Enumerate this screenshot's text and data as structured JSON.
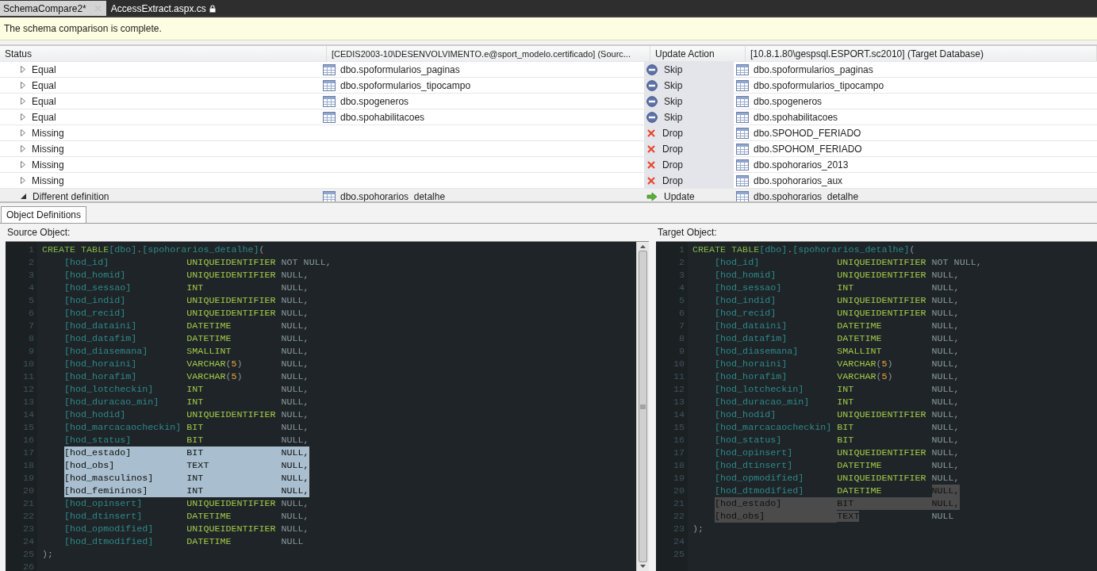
{
  "tabs": [
    {
      "label": "SchemaCompare2*",
      "selected": true,
      "locked": false
    },
    {
      "label": "AccessExtract.aspx.cs",
      "selected": false,
      "locked": true
    }
  ],
  "info_bar": {
    "message": "The schema comparison is complete."
  },
  "grid": {
    "columns": [
      "Status",
      "[CEDIS2003-10\\DESENVOLVIMENTO.e@sport_modelo.certificado] (Sourc...",
      "Update Action",
      "[10.8.1.80\\gespsql.ESPORT.sc2010] (Target Database)"
    ],
    "rows": [
      {
        "status": "Equal",
        "expanded": false,
        "selected": false,
        "source": "dbo.spoformularios_paginas",
        "action": {
          "kind": "skip",
          "label": "Skip"
        },
        "target": "dbo.spoformularios_paginas"
      },
      {
        "status": "Equal",
        "expanded": false,
        "selected": false,
        "source": "dbo.spoformularios_tipocampo",
        "action": {
          "kind": "skip",
          "label": "Skip"
        },
        "target": "dbo.spoformularios_tipocampo"
      },
      {
        "status": "Equal",
        "expanded": false,
        "selected": false,
        "source": "dbo.spogeneros",
        "action": {
          "kind": "skip",
          "label": "Skip"
        },
        "target": "dbo.spogeneros"
      },
      {
        "status": "Equal",
        "expanded": false,
        "selected": false,
        "source": "dbo.spohabilitacoes",
        "action": {
          "kind": "skip",
          "label": "Skip"
        },
        "target": "dbo.spohabilitacoes"
      },
      {
        "status": "Missing",
        "expanded": false,
        "selected": false,
        "action": {
          "kind": "drop",
          "label": "Drop"
        },
        "target": "dbo.SPOHOD_FERIADO"
      },
      {
        "status": "Missing",
        "expanded": false,
        "selected": false,
        "action": {
          "kind": "drop",
          "label": "Drop"
        },
        "target": "dbo.SPOHOM_FERIADO"
      },
      {
        "status": "Missing",
        "expanded": false,
        "selected": false,
        "action": {
          "kind": "drop",
          "label": "Drop"
        },
        "target": "dbo.spohorarios_2013"
      },
      {
        "status": "Missing",
        "expanded": false,
        "selected": false,
        "action": {
          "kind": "drop",
          "label": "Drop"
        },
        "target": "dbo.spohorarios_aux"
      },
      {
        "status": "Different definition",
        "expanded": true,
        "selected": true,
        "source": "dbo.spohorarios_detalhe",
        "action": {
          "kind": "update",
          "label": "Update"
        },
        "target": "dbo.spohorarios_detalhe"
      }
    ]
  },
  "definitions": {
    "tab": {
      "label": "Object Definitions",
      "selected": true
    },
    "panes": [
      {
        "title": "Source Object:",
        "kind": "source",
        "scrollbar": true,
        "lines": [
          {
            "kind": "create",
            "n": "1",
            "keyword": "CREATE TABLE",
            "schema": "[dbo]",
            "dot": ".",
            "table": "[spohorarios_detalhe]",
            "paren": "("
          },
          {
            "kind": "column",
            "n": "2",
            "name": "[hod_id]",
            "type": "UNIQUEIDENTIFIER",
            "nullability": "NOT NULL,",
            "highlight": {
              "name": false,
              "type": false,
              "nullability": false
            }
          },
          {
            "kind": "column",
            "n": "3",
            "name": "[hod_homid]",
            "type": "UNIQUEIDENTIFIER",
            "nullability": "NULL,",
            "highlight": {
              "name": false,
              "type": false,
              "nullability": false
            }
          },
          {
            "kind": "column",
            "n": "4",
            "name": "[hod_sessao]",
            "type": "INT",
            "nullability": "NULL,",
            "highlight": {
              "name": false,
              "type": false,
              "nullability": false
            }
          },
          {
            "kind": "column",
            "n": "5",
            "name": "[hod_indid]",
            "type": "UNIQUEIDENTIFIER",
            "nullability": "NULL,",
            "highlight": {
              "name": false,
              "type": false,
              "nullability": false
            }
          },
          {
            "kind": "column",
            "n": "6",
            "name": "[hod_recid]",
            "type": "UNIQUEIDENTIFIER",
            "nullability": "NULL,",
            "highlight": {
              "name": false,
              "type": false,
              "nullability": false
            }
          },
          {
            "kind": "column",
            "n": "7",
            "name": "[hod_dataini]",
            "type": "DATETIME",
            "nullability": "NULL,",
            "highlight": {
              "name": false,
              "type": false,
              "nullability": false
            }
          },
          {
            "kind": "column",
            "n": "8",
            "name": "[hod_datafim]",
            "type": "DATETIME",
            "nullability": "NULL,",
            "highlight": {
              "name": false,
              "type": false,
              "nullability": false
            }
          },
          {
            "kind": "column",
            "n": "9",
            "name": "[hod_diasemana]",
            "type": "SMALLINT",
            "nullability": "NULL,",
            "highlight": {
              "name": false,
              "type": false,
              "nullability": false
            }
          },
          {
            "kind": "column",
            "n": "10",
            "name": "[hod_horaini]",
            "type": "VARCHAR",
            "size": [
              "(",
              "5",
              ")"
            ],
            "nullability": "NULL,",
            "highlight": {
              "name": false,
              "type": false,
              "nullability": false
            }
          },
          {
            "kind": "column",
            "n": "11",
            "name": "[hod_horafim]",
            "type": "VARCHAR",
            "size": [
              "(",
              "5",
              ")"
            ],
            "nullability": "NULL,",
            "highlight": {
              "name": false,
              "type": false,
              "nullability": false
            }
          },
          {
            "kind": "column",
            "n": "12",
            "name": "[hod_lotcheckin]",
            "type": "INT",
            "nullability": "NULL,",
            "highlight": {
              "name": false,
              "type": false,
              "nullability": false
            }
          },
          {
            "kind": "column",
            "n": "13",
            "name": "[hod_duracao_min]",
            "type": "INT",
            "nullability": "NULL,",
            "highlight": {
              "name": false,
              "type": false,
              "nullability": false
            }
          },
          {
            "kind": "column",
            "n": "14",
            "name": "[hod_hodid]",
            "type": "UNIQUEIDENTIFIER",
            "nullability": "NULL,",
            "highlight": {
              "name": false,
              "type": false,
              "nullability": false
            }
          },
          {
            "kind": "column",
            "n": "15",
            "name": "[hod_marcacaocheckin]",
            "type": "BIT",
            "nullability": "NULL,",
            "highlight": {
              "name": false,
              "type": false,
              "nullability": false
            }
          },
          {
            "kind": "column",
            "n": "16",
            "name": "[hod_status]",
            "type": "BIT",
            "nullability": "NULL,",
            "highlight": {
              "name": false,
              "type": false,
              "nullability": false
            }
          },
          {
            "kind": "column",
            "n": "17",
            "name": "[hod_estado]",
            "type": "BIT",
            "nullability": "NULL,",
            "highlight": {
              "name": true,
              "type": true,
              "nullability": true
            }
          },
          {
            "kind": "column",
            "n": "18",
            "name": "[hod_obs]",
            "type": "TEXT",
            "nullability": "NULL,",
            "highlight": {
              "name": true,
              "type": true,
              "nullability": true
            }
          },
          {
            "kind": "column",
            "n": "19",
            "name": "[hod_masculinos]",
            "type": "INT",
            "nullability": "NULL,",
            "highlight": {
              "name": true,
              "type": true,
              "nullability": true
            }
          },
          {
            "kind": "column",
            "n": "20",
            "name": "[hod_femininos]",
            "type": "INT",
            "nullability": "NULL,",
            "highlight": {
              "name": true,
              "type": true,
              "nullability": true
            }
          },
          {
            "kind": "column",
            "n": "21",
            "name": "[hod_opinsert]",
            "type": "UNIQUEIDENTIFIER",
            "nullability": "NULL,",
            "highlight": {
              "name": false,
              "type": false,
              "nullability": false
            }
          },
          {
            "kind": "column",
            "n": "22",
            "name": "[hod_dtinsert]",
            "type": "DATETIME",
            "nullability": "NULL,",
            "highlight": {
              "name": false,
              "type": false,
              "nullability": false
            }
          },
          {
            "kind": "column",
            "n": "23",
            "name": "[hod_opmodified]",
            "type": "UNIQUEIDENTIFIER",
            "nullability": "NULL,",
            "highlight": {
              "name": false,
              "type": false,
              "nullability": false
            }
          },
          {
            "kind": "column",
            "n": "24",
            "name": "[hod_dtmodified]",
            "type": "DATETIME",
            "nullability": "NULL",
            "highlight": {
              "name": false,
              "type": false,
              "nullability": false
            }
          },
          {
            "kind": "close",
            "n": "25",
            "text": ");"
          },
          {
            "kind": "blank",
            "n": "26"
          }
        ]
      },
      {
        "title": "Target Object:",
        "kind": "target",
        "lines": [
          {
            "kind": "create",
            "n": "1",
            "keyword": "CREATE TABLE",
            "schema": "[dbo]",
            "dot": ".",
            "table": "[spohorarios_detalhe]",
            "paren": "("
          },
          {
            "kind": "column",
            "n": "2",
            "name": "[hod_id]",
            "type": "UNIQUEIDENTIFIER",
            "nullability": "NOT NULL,",
            "highlight": {
              "name": false,
              "type": false,
              "nullability": false
            }
          },
          {
            "kind": "column",
            "n": "3",
            "name": "[hod_homid]",
            "type": "UNIQUEIDENTIFIER",
            "nullability": "NULL,",
            "highlight": {
              "name": false,
              "type": false,
              "nullability": false
            }
          },
          {
            "kind": "column",
            "n": "4",
            "name": "[hod_sessao]",
            "type": "INT",
            "nullability": "NULL,",
            "highlight": {
              "name": false,
              "type": false,
              "nullability": false
            }
          },
          {
            "kind": "column",
            "n": "5",
            "name": "[hod_indid]",
            "type": "UNIQUEIDENTIFIER",
            "nullability": "NULL,",
            "highlight": {
              "name": false,
              "type": false,
              "nullability": false
            }
          },
          {
            "kind": "column",
            "n": "6",
            "name": "[hod_recid]",
            "type": "UNIQUEIDENTIFIER",
            "nullability": "NULL,",
            "highlight": {
              "name": false,
              "type": false,
              "nullability": false
            }
          },
          {
            "kind": "column",
            "n": "7",
            "name": "[hod_dataini]",
            "type": "DATETIME",
            "nullability": "NULL,",
            "highlight": {
              "name": false,
              "type": false,
              "nullability": false
            }
          },
          {
            "kind": "column",
            "n": "8",
            "name": "[hod_datafim]",
            "type": "DATETIME",
            "nullability": "NULL,",
            "highlight": {
              "name": false,
              "type": false,
              "nullability": false
            }
          },
          {
            "kind": "column",
            "n": "9",
            "name": "[hod_diasemana]",
            "type": "SMALLINT",
            "nullability": "NULL,",
            "highlight": {
              "name": false,
              "type": false,
              "nullability": false
            }
          },
          {
            "kind": "column",
            "n": "10",
            "name": "[hod_horaini]",
            "type": "VARCHAR",
            "size": [
              "(",
              "5",
              ")"
            ],
            "nullability": "NULL,",
            "highlight": {
              "name": false,
              "type": false,
              "nullability": false
            }
          },
          {
            "kind": "column",
            "n": "11",
            "name": "[hod_horafim]",
            "type": "VARCHAR",
            "size": [
              "(",
              "5",
              ")"
            ],
            "nullability": "NULL,",
            "highlight": {
              "name": false,
              "type": false,
              "nullability": false
            }
          },
          {
            "kind": "column",
            "n": "12",
            "name": "[hod_lotcheckin]",
            "type": "INT",
            "nullability": "NULL,",
            "highlight": {
              "name": false,
              "type": false,
              "nullability": false
            }
          },
          {
            "kind": "column",
            "n": "13",
            "name": "[hod_duracao_min]",
            "type": "INT",
            "nullability": "NULL,",
            "highlight": {
              "name": false,
              "type": false,
              "nullability": false
            }
          },
          {
            "kind": "column",
            "n": "14",
            "name": "[hod_hodid]",
            "type": "UNIQUEIDENTIFIER",
            "nullability": "NULL,",
            "highlight": {
              "name": false,
              "type": false,
              "nullability": false
            }
          },
          {
            "kind": "column",
            "n": "15",
            "name": "[hod_marcacaocheckin]",
            "type": "BIT",
            "nullability": "NULL,",
            "highlight": {
              "name": false,
              "type": false,
              "nullability": false
            }
          },
          {
            "kind": "column",
            "n": "16",
            "name": "[hod_status]",
            "type": "BIT",
            "nullability": "NULL,",
            "highlight": {
              "name": false,
              "type": false,
              "nullability": false
            }
          },
          {
            "kind": "column",
            "n": "17",
            "name": "[hod_opinsert]",
            "type": "UNIQUEIDENTIFIER",
            "nullability": "NULL,",
            "highlight": {
              "name": false,
              "type": false,
              "nullability": false
            }
          },
          {
            "kind": "column",
            "n": "18",
            "name": "[hod_dtinsert]",
            "type": "DATETIME",
            "nullability": "NULL,",
            "highlight": {
              "name": false,
              "type": false,
              "nullability": false
            }
          },
          {
            "kind": "column",
            "n": "19",
            "name": "[hod_opmodified]",
            "type": "UNIQUEIDENTIFIER",
            "nullability": "NULL,",
            "highlight": {
              "name": false,
              "type": false,
              "nullability": false
            }
          },
          {
            "kind": "column",
            "n": "20",
            "name": "[hod_dtmodified]",
            "type": "DATETIME",
            "nullability": "NULL,",
            "highlight": {
              "name": false,
              "type": false,
              "nullability": true
            }
          },
          {
            "kind": "column",
            "n": "21",
            "name": "[hod_estado]",
            "type": "BIT",
            "nullability": "NULL,",
            "highlight": {
              "name": true,
              "type": true,
              "nullability": true
            }
          },
          {
            "kind": "column",
            "n": "22",
            "name": "[hod_obs]",
            "type": "TEXT",
            "nullability": "NULL",
            "highlight": {
              "name": true,
              "type": true,
              "nullability": false
            }
          },
          {
            "kind": "close",
            "n": "23",
            "text": ");"
          },
          {
            "kind": "blank",
            "n": "24"
          },
          {
            "kind": "blank",
            "n": "25"
          }
        ]
      }
    ]
  }
}
